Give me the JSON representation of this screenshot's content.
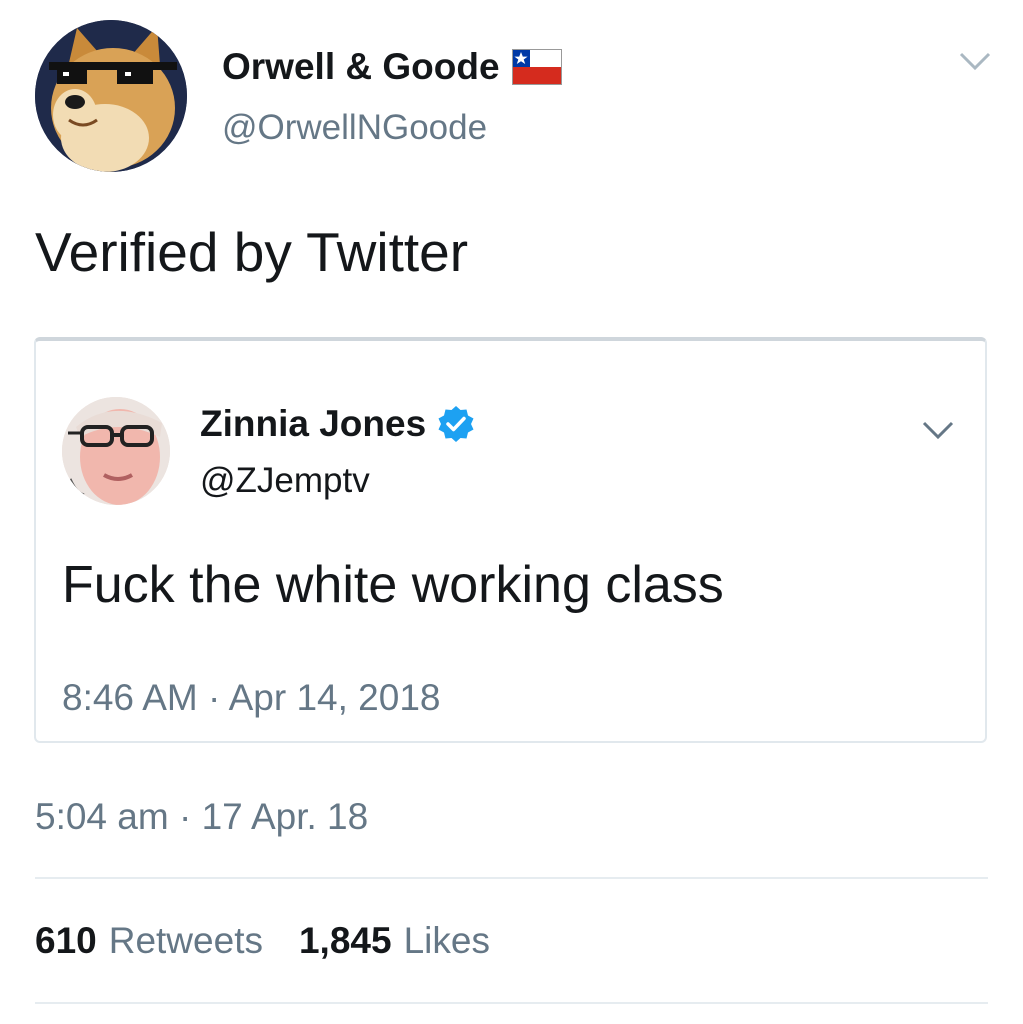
{
  "author": {
    "name": "Orwell & Goode",
    "handle": "@OrwellNGoode"
  },
  "tweet": {
    "text": "Verified by Twitter",
    "timestamp": "5:04 am · 17 Apr. 18"
  },
  "quoted_tweet": {
    "name": "Zinnia Jones",
    "handle": "@ZJemptv",
    "text": "Fuck the white working class",
    "timestamp": "8:46 AM · Apr 14, 2018"
  },
  "stats": {
    "retweets_count": "610",
    "retweets_label": "Retweets",
    "likes_count": "1,845",
    "likes_label": "Likes"
  },
  "icons": {
    "author_avatar": "doge-with-sunglasses-avatar",
    "flag": "chile-flag-icon",
    "verified": "verified-badge-icon",
    "menu": "chevron-down-icon"
  },
  "colors": {
    "text_primary": "#14171a",
    "text_secondary": "#657786",
    "verified_blue": "#1da1f2",
    "divider": "#e6ecf0"
  }
}
